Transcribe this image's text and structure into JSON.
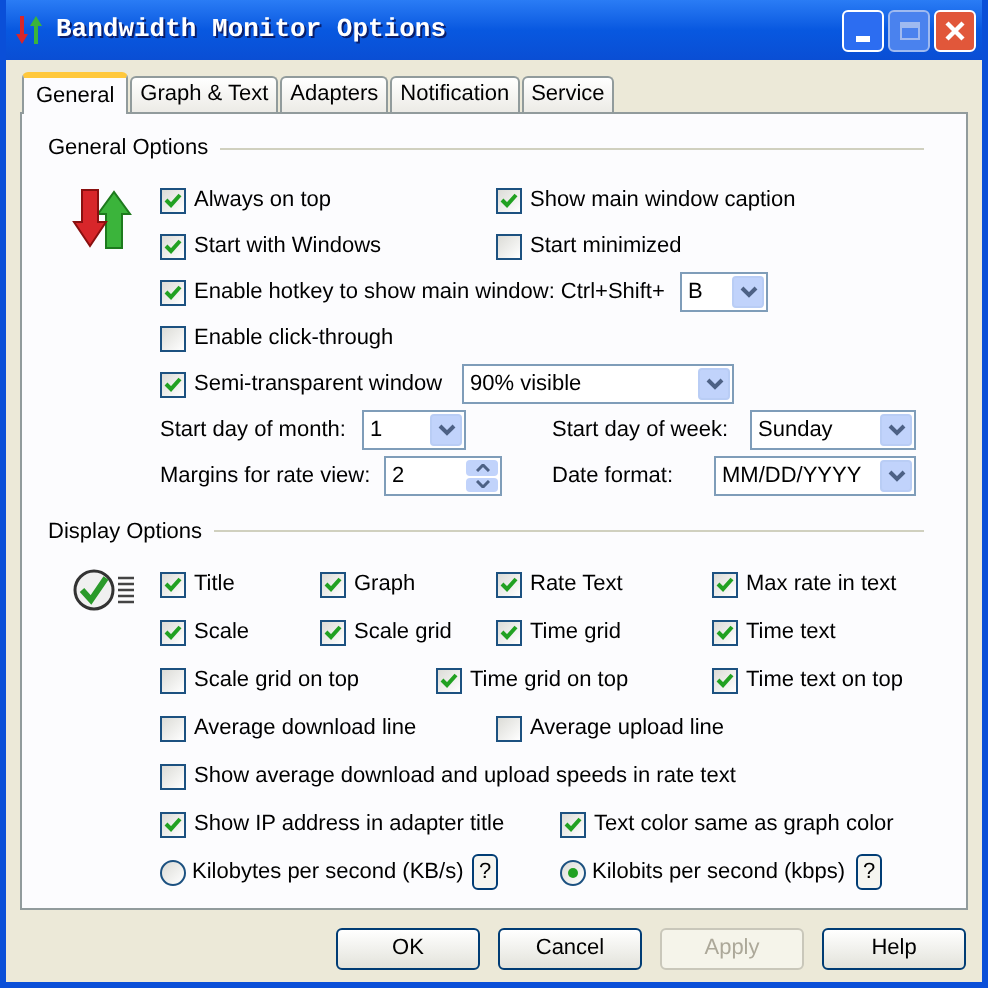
{
  "window": {
    "title": "Bandwidth Monitor Options"
  },
  "tabs": [
    {
      "label": "General",
      "selected": true
    },
    {
      "label": "Graph & Text",
      "selected": false
    },
    {
      "label": "Adapters",
      "selected": false
    },
    {
      "label": "Notification",
      "selected": false
    },
    {
      "label": "Service",
      "selected": false
    }
  ],
  "general_options": {
    "heading": "General Options",
    "rows": [
      [
        {
          "kind": "checkbox",
          "label": "Always on top",
          "checked": true
        },
        {
          "kind": "checkbox",
          "label": "Show main window caption",
          "checked": true
        }
      ],
      [
        {
          "kind": "checkbox",
          "label": "Start with Windows",
          "checked": true
        },
        {
          "kind": "checkbox",
          "label": "Start minimized",
          "checked": false
        }
      ],
      [
        {
          "kind": "checkbox",
          "label": "Enable hotkey to show main window: Ctrl+Shift+",
          "checked": true,
          "dropdown": "B"
        }
      ],
      [
        {
          "kind": "checkbox",
          "label": "Enable click-through",
          "checked": false
        }
      ],
      [
        {
          "kind": "checkbox",
          "label": "Semi-transparent window",
          "checked": true,
          "dropdown": "90% visible"
        }
      ],
      [
        {
          "kind": "dropdown",
          "label": "Start day of month:",
          "value": "1"
        },
        {
          "kind": "dropdown",
          "label": "Start day of week:",
          "value": "Sunday"
        }
      ],
      [
        {
          "kind": "spinner",
          "label": "Margins for rate view:",
          "value": "2"
        },
        {
          "kind": "dropdown",
          "label": "Date format:",
          "value": "MM/DD/YYYY"
        }
      ]
    ]
  },
  "display_options": {
    "heading": "Display Options",
    "rows": [
      [
        {
          "kind": "checkbox",
          "label": "Title",
          "checked": true
        },
        {
          "kind": "checkbox",
          "label": "Graph",
          "checked": true
        },
        {
          "kind": "checkbox",
          "label": "Rate Text",
          "checked": true
        },
        {
          "kind": "checkbox",
          "label": "Max rate in text",
          "checked": true
        }
      ],
      [
        {
          "kind": "checkbox",
          "label": "Scale",
          "checked": true
        },
        {
          "kind": "checkbox",
          "label": "Scale grid",
          "checked": true
        },
        {
          "kind": "checkbox",
          "label": "Time grid",
          "checked": true
        },
        {
          "kind": "checkbox",
          "label": "Time text",
          "checked": true
        }
      ],
      [
        {
          "kind": "checkbox",
          "label": "Scale grid on top",
          "checked": false
        },
        {
          "kind": "checkbox",
          "label": "Time grid on top",
          "checked": true
        },
        {
          "kind": "checkbox",
          "label": "Time text on top",
          "checked": true
        }
      ],
      [
        {
          "kind": "checkbox",
          "label": "Average download line",
          "checked": false
        },
        {
          "kind": "checkbox",
          "label": "Average upload line",
          "checked": false
        }
      ],
      [
        {
          "kind": "checkbox",
          "label": "Show average download and upload speeds in rate text",
          "checked": false
        }
      ],
      [
        {
          "kind": "checkbox",
          "label": "Show IP address in adapter title",
          "checked": true
        },
        {
          "kind": "checkbox",
          "label": "Text color same as graph color",
          "checked": true
        }
      ],
      [
        {
          "kind": "radio",
          "label": "Kilobytes per second (KB/s)",
          "selected": false
        },
        {
          "kind": "help",
          "label": "?"
        },
        {
          "kind": "radio",
          "label": "Kilobits per second (kbps)",
          "selected": true
        },
        {
          "kind": "help",
          "label": "?"
        }
      ]
    ]
  },
  "buttons": [
    {
      "label": "OK",
      "disabled": false
    },
    {
      "label": "Cancel",
      "disabled": false
    },
    {
      "label": "Apply",
      "disabled": true
    },
    {
      "label": "Help",
      "disabled": false
    }
  ]
}
